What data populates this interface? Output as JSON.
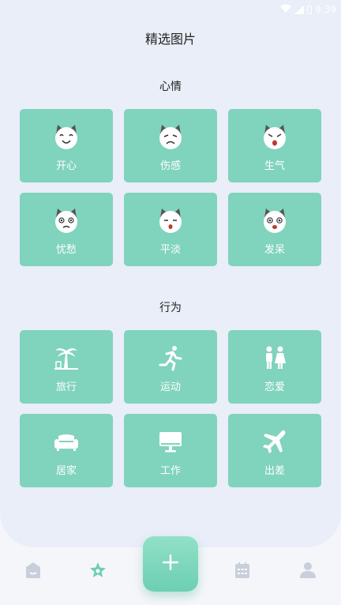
{
  "status_bar": {
    "time": "9:39"
  },
  "page_title": "精选图片",
  "sections": [
    {
      "title": "心情",
      "items": [
        {
          "label": "开心",
          "icon": "cat-happy-face-icon"
        },
        {
          "label": "伤感",
          "icon": "cat-sad-face-icon"
        },
        {
          "label": "生气",
          "icon": "cat-angry-face-icon"
        },
        {
          "label": "忧愁",
          "icon": "cat-worried-face-icon"
        },
        {
          "label": "平淡",
          "icon": "cat-calm-face-icon"
        },
        {
          "label": "发呆",
          "icon": "cat-dazed-face-icon"
        }
      ]
    },
    {
      "title": "行为",
      "items": [
        {
          "label": "旅行",
          "icon": "palm-tree-icon"
        },
        {
          "label": "运动",
          "icon": "running-person-icon"
        },
        {
          "label": "恋爱",
          "icon": "couple-icon"
        },
        {
          "label": "居家",
          "icon": "sofa-icon"
        },
        {
          "label": "工作",
          "icon": "monitor-icon"
        },
        {
          "label": "出差",
          "icon": "airplane-icon"
        }
      ]
    }
  ],
  "tab_bar": {
    "items": [
      "home-icon",
      "star-icon",
      "add-icon",
      "calendar-icon",
      "user-icon"
    ],
    "active": "star-icon"
  },
  "colors": {
    "accent": "#80d3bc",
    "background": "#e9eef8",
    "inactive_tab": "#c8cfdc"
  }
}
